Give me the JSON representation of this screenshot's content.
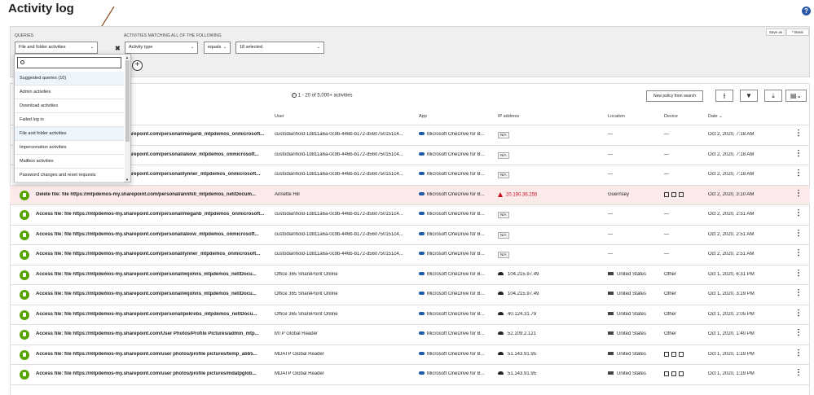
{
  "page": {
    "title": "Activity log",
    "help_icon": "help-icon"
  },
  "filters": {
    "queries_label": "QUERIES",
    "queries_selected": "File and folder activities",
    "activities_label": "ACTIVITIES MATCHING ALL OF THE FOLLOWING",
    "field": "Activity type",
    "operator": "equals",
    "value": "18 selected",
    "save_as": "Save as",
    "basic": "Basic"
  },
  "dropdown": {
    "items": [
      "Suggested queries (10)",
      "Admin activities",
      "Download activities",
      "Failed log in",
      "File and folder activities",
      "Impersonation activities",
      "Mailbox activities",
      "Password changes and reset requests"
    ]
  },
  "toolbar": {
    "count_text": "1 - 20 of 5,000+ activities",
    "new_policy": "New policy from search"
  },
  "columns": {
    "user": "User",
    "app": "App",
    "ip": "IP address",
    "location": "Location",
    "device": "Device",
    "date": "Date"
  },
  "rows": [
    {
      "desc": "Access file: file https://mtpdemos-my.sharepoint.com/personal/meganb_mtpdemos_onmicrosoft...",
      "user": "custodianhold-1d811a6a-0c9b-446b-b172-d560750151c4...",
      "app": "Microsoft OneDrive for B...",
      "ip": "N/A",
      "ip_type": "na",
      "location": "—",
      "device": "—",
      "date": "Oct 2, 2020, 7:18 AM"
    },
    {
      "desc": "Access file: file https://mtpdemos-my.sharepoint.com/personal/alexw_mtpdemos_onmicrosoft...",
      "user": "custodianhold-1d811a6a-0c9b-446b-b172-d560750151c4...",
      "app": "Microsoft OneDrive for B...",
      "ip": "N/A",
      "ip_type": "na",
      "location": "—",
      "device": "—",
      "date": "Oct 2, 2020, 7:18 AM"
    },
    {
      "desc": "Access file: file https://mtpdemos-my.sharepoint.com/personal/lynner_mtpdemos_onmicrosoft...",
      "user": "custodianhold-1d811a6a-0c9b-446b-b172-d560750151c4...",
      "app": "Microsoft OneDrive for B...",
      "ip": "N/A",
      "ip_type": "na",
      "location": "—",
      "device": "—",
      "date": "Oct 2, 2020, 7:18 AM"
    },
    {
      "desc": "Delete file: file https://mtpdemos-my.sharepoint.com/personal/annhill_mtpdemos_net/Docum...",
      "user": "Annette Hill",
      "app": "Microsoft OneDrive for B...",
      "ip": "20.190.36.255",
      "ip_type": "warn",
      "location": "Guernsey",
      "device": "icons",
      "date": "Oct 2, 2020, 3:10 AM",
      "alert": true
    },
    {
      "desc": "Access file: file https://mtpdemos-my.sharepoint.com/personal/meganb_mtpdemos_onmicrosoft...",
      "user": "custodianhold-1d811a6a-0c9b-446b-b172-d560750151c4...",
      "app": "Microsoft OneDrive for B...",
      "ip": "N/A",
      "ip_type": "na",
      "location": "—",
      "device": "—",
      "date": "Oct 2, 2020, 2:51 AM"
    },
    {
      "desc": "Access file: file https://mtpdemos-my.sharepoint.com/personal/alexw_mtpdemos_onmicrosoft...",
      "user": "custodianhold-1d811a6a-0c9b-446b-b172-d560750151c4...",
      "app": "Microsoft OneDrive for B...",
      "ip": "N/A",
      "ip_type": "na",
      "location": "—",
      "device": "—",
      "date": "Oct 2, 2020, 2:51 AM"
    },
    {
      "desc": "Access file: file https://mtpdemos-my.sharepoint.com/personal/lynner_mtpdemos_onmicrosoft...",
      "user": "custodianhold-1d811a6a-0c9b-446b-b172-d560750151c4...",
      "app": "Microsoft OneDrive for B...",
      "ip": "N/A",
      "ip_type": "na",
      "location": "—",
      "device": "—",
      "date": "Oct 2, 2020, 2:51 AM"
    },
    {
      "desc": "Access file: file https://mtpdemos-my.sharepoint.com/personal/wijohns_mtpdemos_net/Docu...",
      "user": "Office 365 SharePoint Online",
      "app": "Microsoft OneDrive for B...",
      "ip": "104.215.97.49",
      "ip_type": "cloud",
      "location": "United States",
      "device": "Other",
      "date": "Oct 1, 2020, 6:31 PM"
    },
    {
      "desc": "Access file: file https://mtpdemos-my.sharepoint.com/personal/wijohns_mtpdemos_net/Docu...",
      "user": "Office 365 SharePoint Online",
      "app": "Microsoft OneDrive for B...",
      "ip": "104.215.97.49",
      "ip_type": "cloud",
      "location": "United States",
      "device": "Other",
      "date": "Oct 1, 2020, 3:19 PM"
    },
    {
      "desc": "Access file: file https://mtpdemos-my.sharepoint.com/personal/pekrebs_mtpdemos_net/Docu...",
      "user": "Office 365 SharePoint Online",
      "app": "Microsoft OneDrive for B...",
      "ip": "40.124.31.79",
      "ip_type": "cloud",
      "location": "United States",
      "device": "Other",
      "date": "Oct 1, 2020, 2:05 PM"
    },
    {
      "desc": "Access file: file https://mtpdemos-my.sharepoint.com/User Photos/Profile Pictures/admin_mtp...",
      "user": "MTP Global Reader",
      "app": "Microsoft OneDrive for B...",
      "ip": "52.109.2.121",
      "ip_type": "cloud",
      "location": "United States",
      "device": "Other",
      "date": "Oct 1, 2020, 1:40 PM"
    },
    {
      "desc": "Access file: file https://mtpdemos-my.sharepoint.com/user photos/profile pictures/temp_abb5...",
      "user": "MDATP Global Reader",
      "app": "Microsoft OneDrive for B...",
      "ip": "51.143.91.95",
      "ip_type": "cloud",
      "location": "United States",
      "device": "icons",
      "date": "Oct 1, 2020, 1:19 PM"
    },
    {
      "desc": "Access file: file https://mtpdemos-my.sharepoint.com/user photos/profile pictures/mdatpglob...",
      "user": "MDATP Global Reader",
      "app": "Microsoft OneDrive for B...",
      "ip": "51.143.91.95",
      "ip_type": "cloud",
      "location": "United States",
      "device": "icons",
      "date": "Oct 1, 2020, 1:19 PM"
    }
  ]
}
